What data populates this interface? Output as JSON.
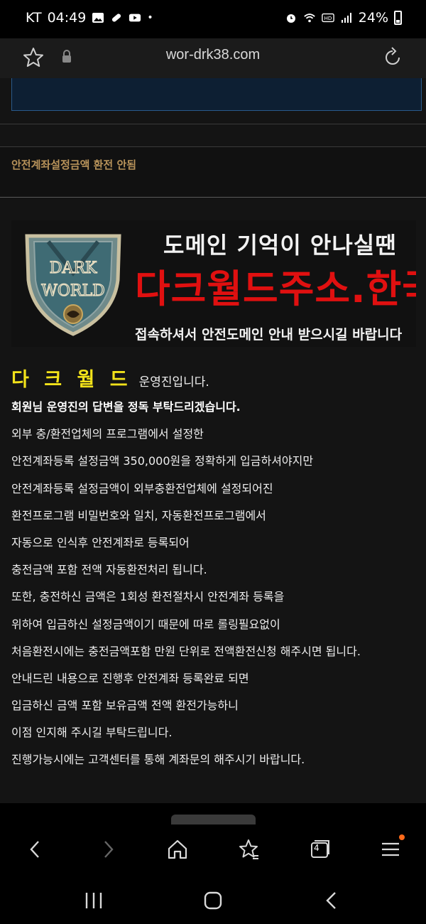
{
  "status_bar": {
    "carrier": "KT",
    "time": "04:49",
    "battery_percent": "24%"
  },
  "browser": {
    "url": "wor-drk38.com",
    "tabs_count": "4"
  },
  "post": {
    "title": "안전계좌설정금액 환전 안됨"
  },
  "banner": {
    "line1": "도메인 기억이 안나실땐",
    "line2": "다크월드주소.한국",
    "line3": "접속하셔서 안전도메인 안내 받으시길 바랍니다",
    "logo_top": "DARK",
    "logo_bottom": "WORLD"
  },
  "message": {
    "brand": "다 크 월 드",
    "operator": "운영진입니다.",
    "lines": [
      "회원님 운영진의 답변을 정독 부탁드리겠습니다.",
      "외부 충/환전업체의 프로그램에서 설정한",
      "안전계좌등록 설정금액 350,000원을 정확하게 입금하셔야지만",
      "안전계좌등록 설정금액이 외부충환전업체에 설정되어진",
      "환전프로그램 비밀번호와 일치, 자동환전프로그램에서",
      "자동으로 인식후 안전계좌로 등록되어",
      "충전금액 포함 전액 자동환전처리 됩니다.",
      "또한, 충전하신 금액은 1회성 환전절차시 안전계좌 등록을",
      "위하여 입금하신 설정금액이기 때문에 따로 롤링필요없이",
      "처음환전시에는 충전금액포함 만원 단위로 전액환전신청 해주시면 됩니다.",
      "안내드린 내용으로 진행후 안전계좌 등록완료 되면",
      "입금하신 금액 포함 보유금액 전액 환전가능하니",
      "이점 인지해 주시길 부탁드립니다.",
      "진행가능시에는 고객센터를 통해 계좌문의 해주시기 바랍니다."
    ]
  },
  "colors": {
    "title_gold": "#b8935a",
    "brand_yellow": "#f2e21a",
    "banner_red": "#e01010",
    "notification_dot": "#ff6a1a"
  }
}
